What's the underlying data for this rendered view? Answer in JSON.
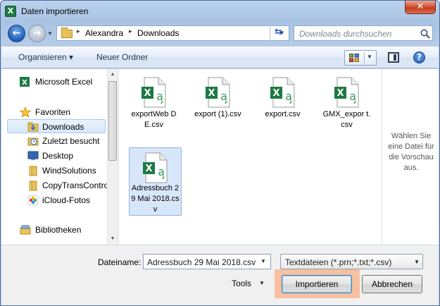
{
  "window": {
    "title": "Daten importieren",
    "app_icon_letter": "X",
    "close_glyph": "✕"
  },
  "address": {
    "path": [
      "Alexandra",
      "Downloads"
    ],
    "separator": "▸"
  },
  "search": {
    "placeholder": "Downloads durchsuchen"
  },
  "toolbar": {
    "organize": "Organisieren ▾",
    "new_folder": "Neuer Ordner",
    "help": "?"
  },
  "nav": {
    "items": [
      {
        "label": "Microsoft Excel",
        "icon": "excel-icon"
      },
      {
        "label": "Favoriten",
        "icon": "star-icon"
      },
      {
        "label": "Downloads",
        "icon": "downloads-folder-icon",
        "selected": true
      },
      {
        "label": "Zuletzt besucht",
        "icon": "recent-places-icon"
      },
      {
        "label": "Desktop",
        "icon": "desktop-icon"
      },
      {
        "label": "WindSolutions",
        "icon": "folder-icon"
      },
      {
        "label": "CopyTransControl",
        "icon": "folder-icon"
      },
      {
        "label": "iCloud-Fotos",
        "icon": "icloud-photos-icon"
      },
      {
        "label": "Bibliotheken",
        "icon": "libraries-icon"
      }
    ]
  },
  "files": [
    {
      "name": "exportWebDE.csv",
      "display": "exportWeb DE.csv"
    },
    {
      "name": "export (1).csv",
      "display": "export (1).csv"
    },
    {
      "name": "export.csv",
      "display": "export.csv"
    },
    {
      "name": "GMX_export.csv",
      "display": "GMX_expor t.csv"
    },
    {
      "name": "Adressbuch 29 Mai 2018.csv",
      "display": "Adressbuch 29 Mai 2018.csv",
      "selected": true
    }
  ],
  "preview": {
    "message": "Wählen Sie eine Datei für die Vorschau aus."
  },
  "bottom": {
    "filename_label": "Dateiname:",
    "filename_value": "Adressbuch 29 Mai 2018.csv",
    "filter_value": "Textdateien (*.prn;*.txt;*.csv)",
    "tools_label": "Tools",
    "import_label": "Importieren",
    "cancel_label": "Abbrechen"
  },
  "colors": {
    "excel_green": "#1d7a44",
    "selection": "#d8e6fa",
    "import_highlight": "#f6c0a1"
  }
}
